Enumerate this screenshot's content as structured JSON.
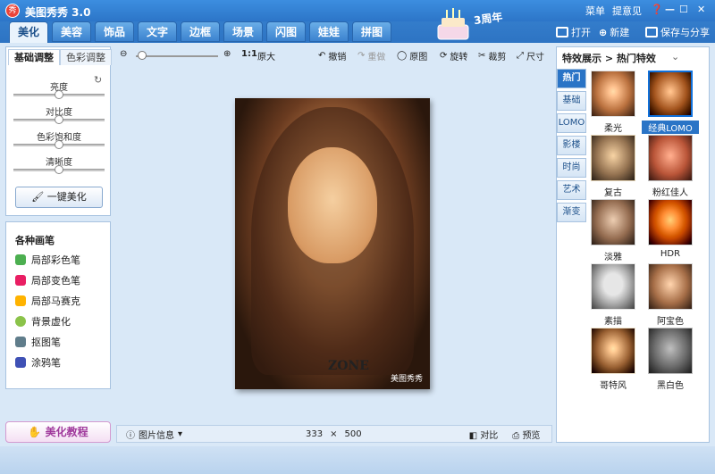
{
  "app": {
    "title": "美图秀秀 3.0",
    "logo_text": "秀",
    "anniversary": "3周年"
  },
  "window": {
    "menu": "菜单",
    "feedback": "提意见"
  },
  "tabs": [
    "美化",
    "美容",
    "饰品",
    "文字",
    "边框",
    "场景",
    "闪图",
    "娃娃",
    "拼图"
  ],
  "top_actions": {
    "open": "打开",
    "new": "新建",
    "save": "保存与分享"
  },
  "left": {
    "tab_basic": "基础调整",
    "tab_color": "色彩调整",
    "sliders": [
      "亮度",
      "对比度",
      "色彩饱和度",
      "清晰度"
    ],
    "one_click": "一键美化",
    "brushes_title": "各种画笔",
    "brushes": [
      "局部彩色笔",
      "局部变色笔",
      "局部马赛克",
      "背景虚化",
      "抠图笔",
      "涂鸦笔"
    ],
    "tutorial": "美化教程"
  },
  "toolbar": {
    "zoom_ratio": "1:1",
    "original_size": "原大",
    "undo": "撤销",
    "redo": "重做",
    "original": "原图",
    "rotate": "旋转",
    "crop": "裁剪",
    "size": "尺寸"
  },
  "canvas": {
    "watermark": "美图秀秀",
    "photo_text": "ZONE"
  },
  "status": {
    "info": "图片信息",
    "width": "333",
    "times": "×",
    "height": "500",
    "compare": "对比",
    "preview": "预览"
  },
  "right": {
    "header": "特效展示 > 热门特效",
    "categories": [
      "热门",
      "基础",
      "LOMO",
      "影楼",
      "时尚",
      "艺术",
      "渐变"
    ],
    "effects": [
      "柔光",
      "经典LOMO",
      "复古",
      "粉红佳人",
      "淡雅",
      "HDR",
      "素描",
      "阿宝色",
      "哥特风",
      "黑白色"
    ]
  }
}
